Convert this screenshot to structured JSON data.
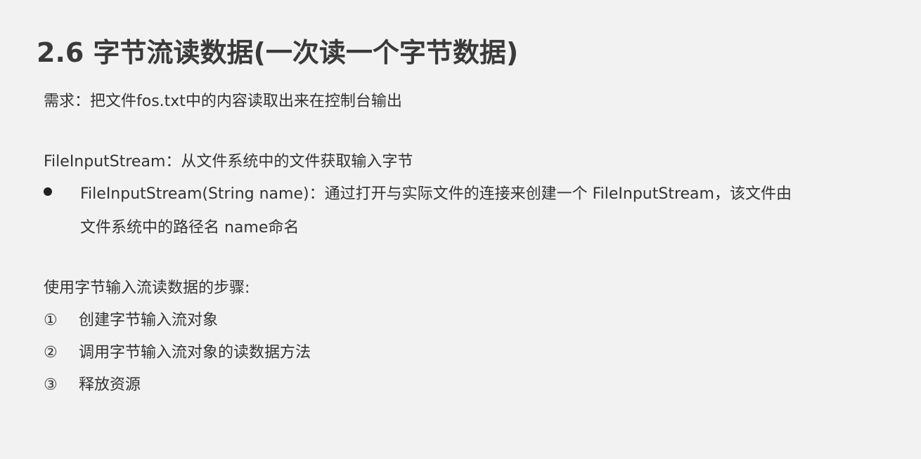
{
  "title": "2.6 字节流读数据(一次读一个字节数据)",
  "requirement": "需求：把文件fos.txt中的内容读取出来在控制台输出",
  "fis_definition": "FileInputStream：从文件系统中的文件获取输入字节",
  "constructor_line1": "FileInputStream(String name)：通过打开与实际文件的连接来创建一个 FileInputStream，该文件由",
  "constructor_line2": "文件系统中的路径名 name命名",
  "steps_title": "使用字节输入流读数据的步骤:",
  "steps": [
    {
      "num": "①",
      "text": "创建字节输入流对象"
    },
    {
      "num": "②",
      "text": "调用字节输入流对象的读数据方法"
    },
    {
      "num": "③",
      "text": "释放资源"
    }
  ]
}
